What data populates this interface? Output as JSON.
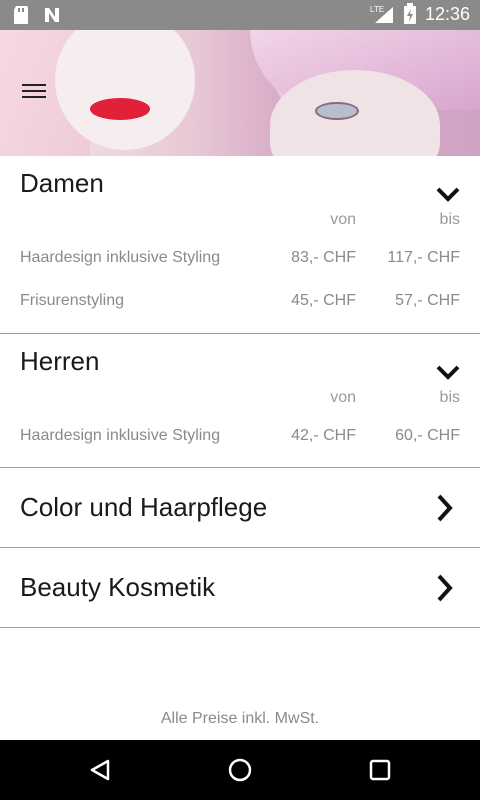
{
  "status": {
    "time": "12:36",
    "network": "LTE"
  },
  "sections": [
    {
      "title": "Damen",
      "von_label": "von",
      "bis_label": "bis",
      "rows": [
        {
          "name": "Haardesign inklusive Styling",
          "von": "83,- CHF",
          "bis": "117,- CHF"
        },
        {
          "name": "Frisurenstyling",
          "von": "45,- CHF",
          "bis": "57,- CHF"
        }
      ]
    },
    {
      "title": "Herren",
      "von_label": "von",
      "bis_label": "bis",
      "rows": [
        {
          "name": "Haardesign inklusive Styling",
          "von": "42,- CHF",
          "bis": "60,- CHF"
        }
      ]
    },
    {
      "title": "Color und Haarpflege"
    },
    {
      "title": "Beauty Kosmetik"
    }
  ],
  "footer": "Alle Preise inkl. MwSt.",
  "colors": {
    "status_bar": "#8a8a8a",
    "nav_bar": "#000000",
    "divider": "#9e9e9e",
    "lips": "#e2203a"
  }
}
